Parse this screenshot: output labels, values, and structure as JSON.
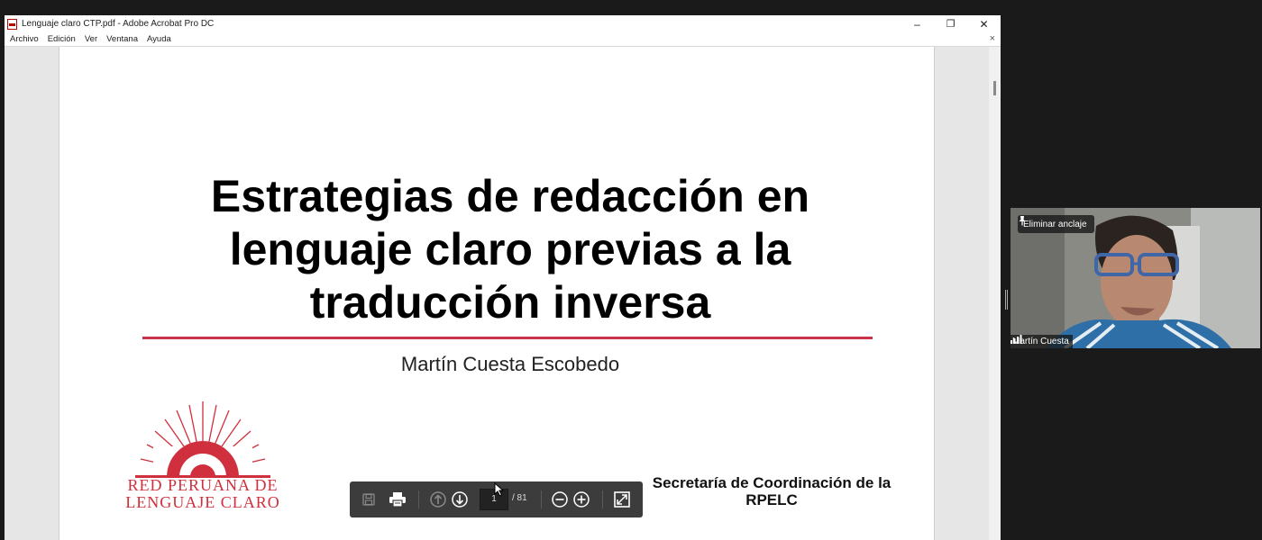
{
  "window": {
    "title": "Lenguaje claro CTP.pdf - Adobe Acrobat Pro DC",
    "controls": {
      "minimize": "–",
      "maximize": "❐",
      "close": "✕"
    }
  },
  "menu": {
    "items": [
      "Archivo",
      "Edición",
      "Ver",
      "Ventana",
      "Ayuda"
    ],
    "close": "×"
  },
  "slide": {
    "title_lines": [
      "Estrategias de redacción en",
      "lenguaje claro previas a la",
      "traducción inversa"
    ],
    "author": "Martín Cuesta Escobedo",
    "secretaria_lines": [
      "Secretaría de Coordinación de la",
      "RPELC"
    ],
    "logo_lines": [
      "RED PERUANA DE",
      "LENGUAJE CLARO"
    ],
    "accent_color": "#c8324a"
  },
  "toolbar": {
    "current_page": "1",
    "total_pages": "/ 81",
    "icons": [
      "save-icon",
      "print-icon",
      "page-up-icon",
      "page-down-icon",
      "zoom-out-icon",
      "zoom-in-icon",
      "fit-page-icon"
    ]
  },
  "video": {
    "unpin_label": "Eliminar anclaje",
    "participant_name": "Martín Cuesta"
  }
}
